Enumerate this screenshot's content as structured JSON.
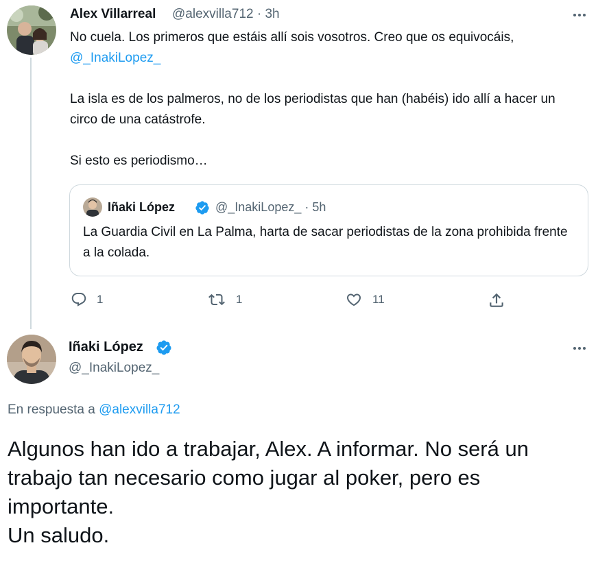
{
  "tweet1": {
    "display_name": "Alex Villarreal",
    "meta": "@alexvilla712 · 3h",
    "paragraph1_text": "No cuela. Los primeros que estáis allí sois vosotros. Creo que os equivocáis, ",
    "paragraph1_mention": "@_InakiLopez_",
    "paragraph2": "La isla es de los palmeros, no de los periodistas que han (habéis) ido allí a hacer un circo de una catástrofe.",
    "paragraph3": "Si esto es periodismo…",
    "quoted": {
      "display_name": "Iñaki López",
      "meta": "@_InakiLopez_ · 5h",
      "text": "La Guardia Civil en La Palma, harta de sacar periodistas de la zona prohibida frente a la colada."
    },
    "actions": {
      "reply_count": "1",
      "retweet_count": "1",
      "like_count": "11"
    }
  },
  "tweet2": {
    "display_name": "Iñaki López",
    "handle": "@_InakiLopez_",
    "reply_prefix": "En respuesta a ",
    "reply_mention": "@alexvilla712",
    "text_lines": [
      "Algunos han ido a trabajar, Alex. A informar. No será un trabajo tan necesario como jugar al poker, pero es importante.",
      "Un saludo."
    ]
  },
  "icons": {
    "more": "more-horizontal-icon",
    "verified": "verified-badge-icon",
    "reply": "reply-icon",
    "retweet": "retweet-icon",
    "like": "heart-icon",
    "share": "share-icon"
  },
  "colors": {
    "accent": "#1d9bf0",
    "secondary_text": "#536471",
    "border": "#cfd9de",
    "text": "#0f1419"
  }
}
